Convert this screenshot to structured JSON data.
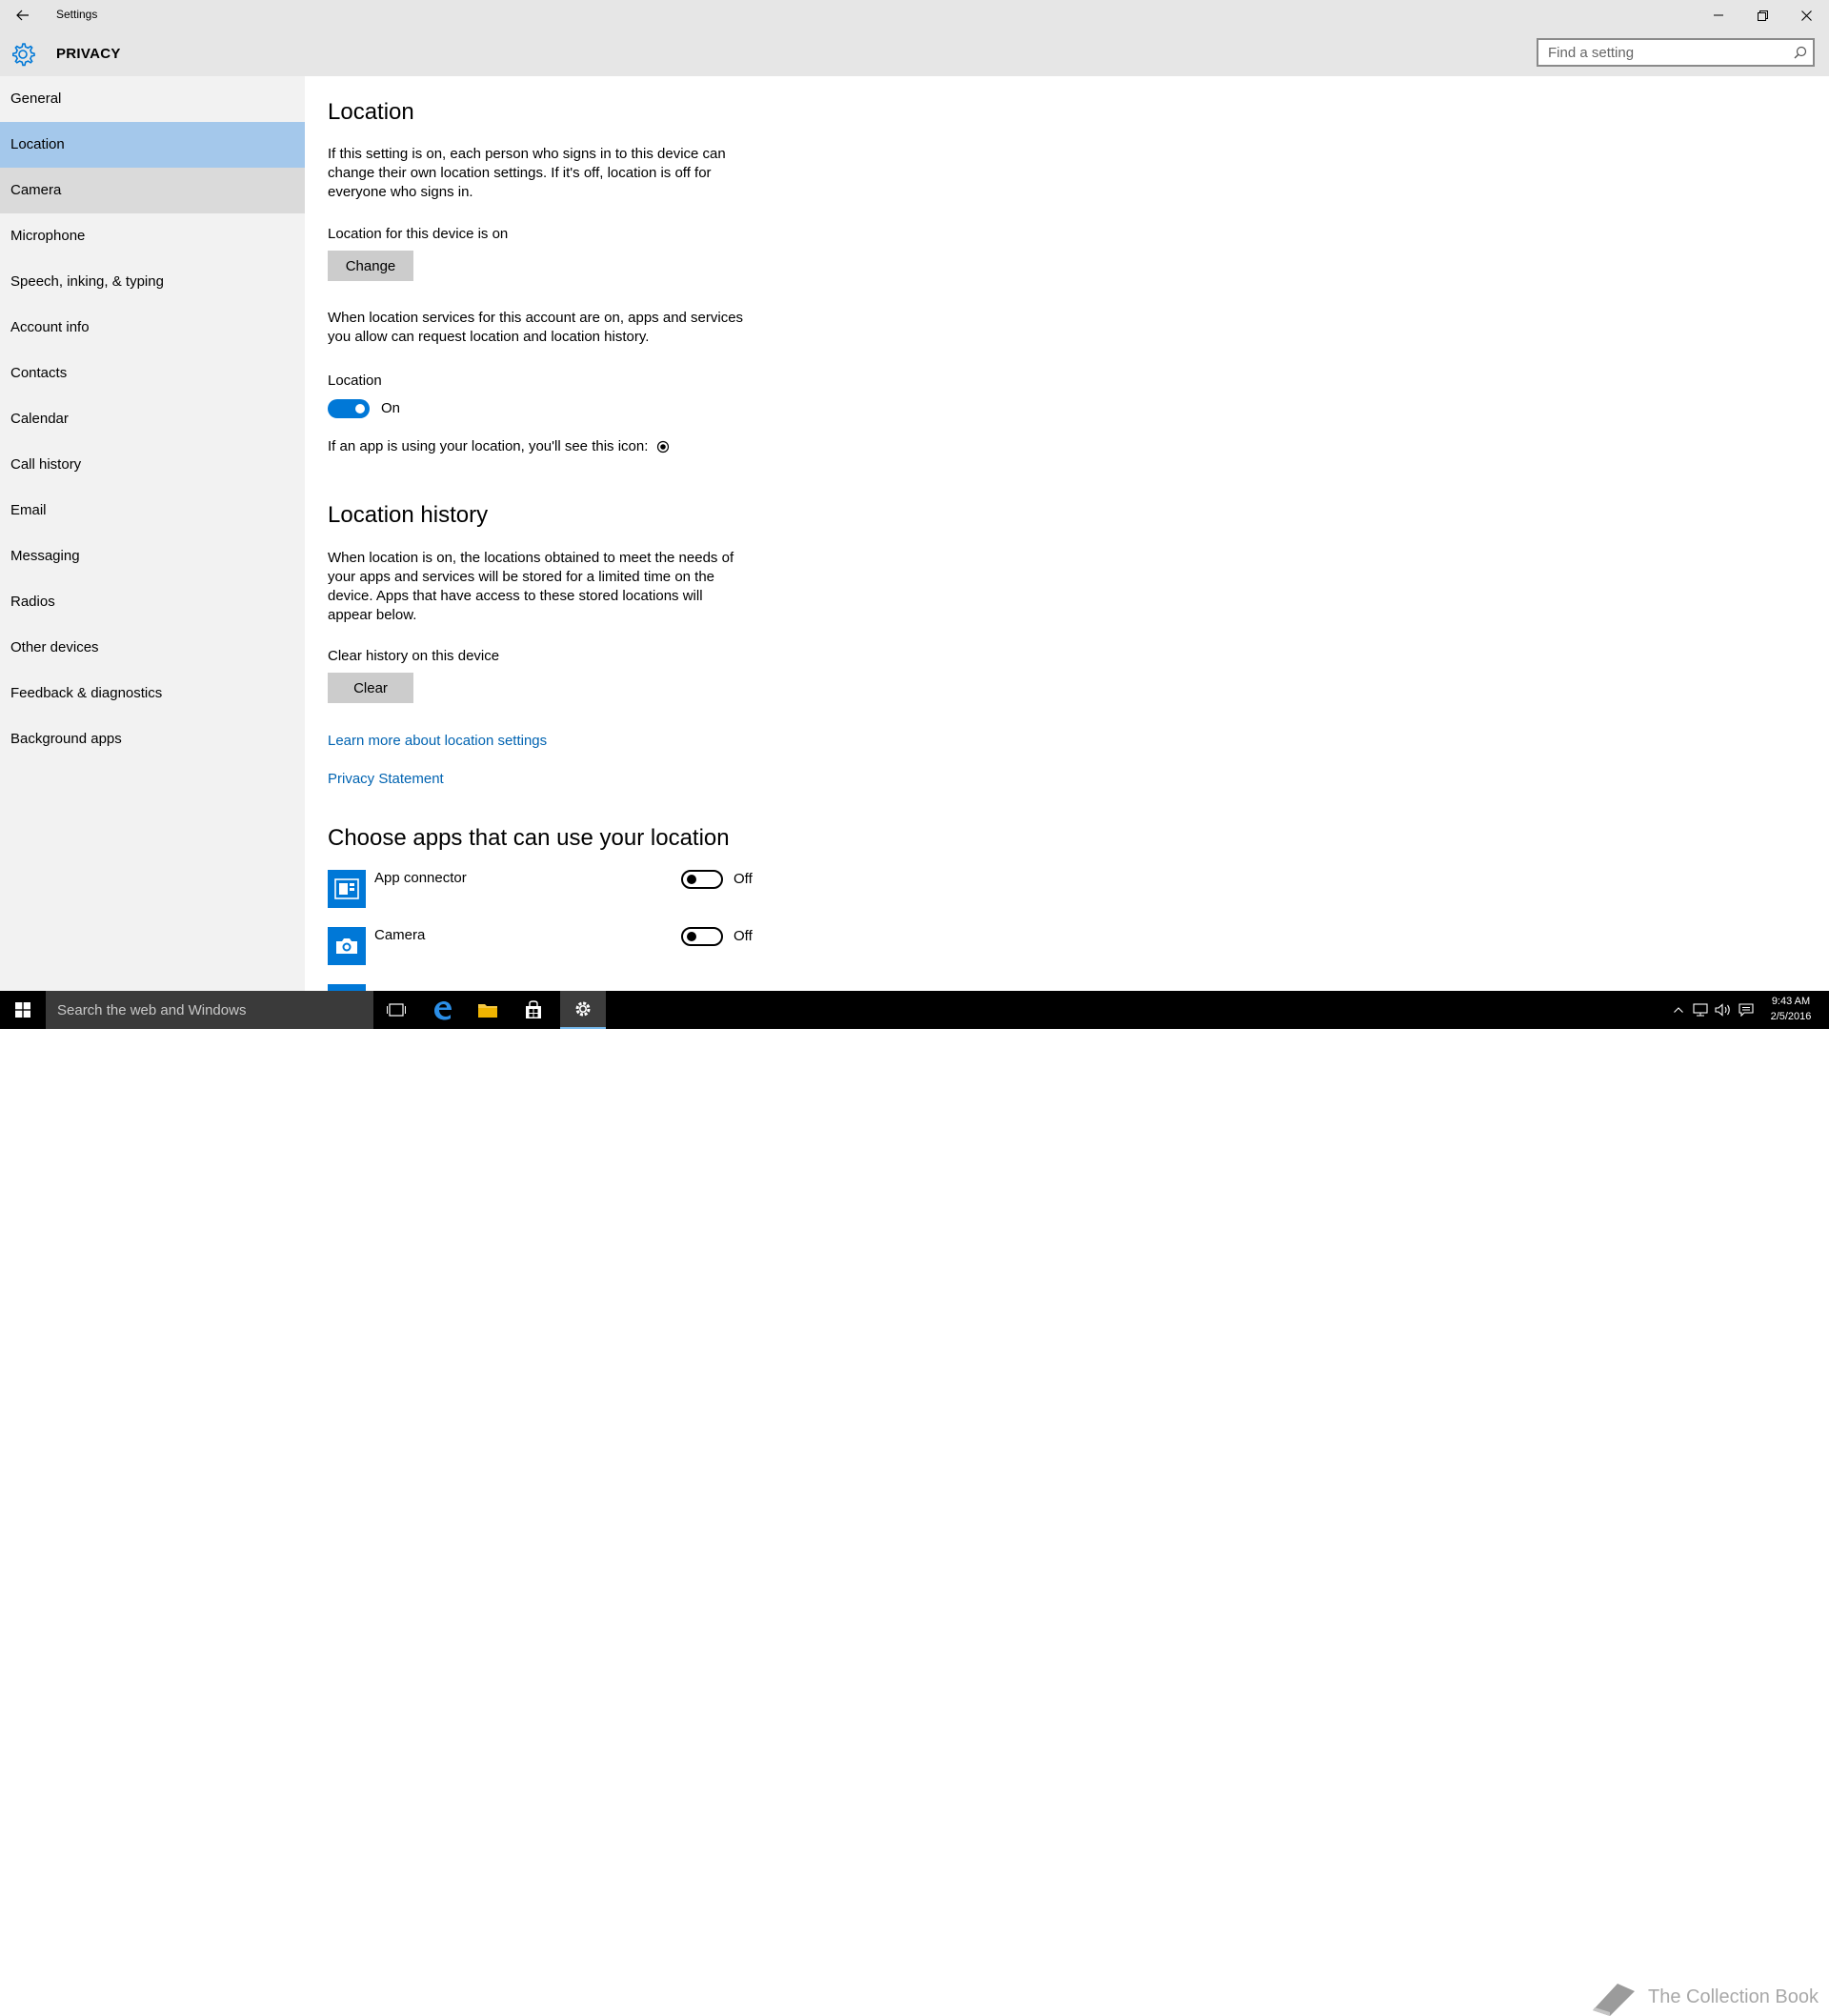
{
  "window": {
    "app_title": "Settings",
    "section_title": "PRIVACY",
    "search_placeholder": "Find a setting"
  },
  "sidebar": {
    "items": [
      {
        "label": "General"
      },
      {
        "label": "Location",
        "state": "selected"
      },
      {
        "label": "Camera",
        "state": "hover"
      },
      {
        "label": "Microphone"
      },
      {
        "label": "Speech, inking, & typing"
      },
      {
        "label": "Account info"
      },
      {
        "label": "Contacts"
      },
      {
        "label": "Calendar"
      },
      {
        "label": "Call history"
      },
      {
        "label": "Email"
      },
      {
        "label": "Messaging"
      },
      {
        "label": "Radios"
      },
      {
        "label": "Other devices"
      },
      {
        "label": "Feedback & diagnostics"
      },
      {
        "label": "Background apps"
      }
    ]
  },
  "main": {
    "location": {
      "heading": "Location",
      "description": "If this setting is on, each person who signs in to this device can change their own location settings. If it's off, location is off for everyone who signs in.",
      "device_status": "Location for this device is on",
      "change_button": "Change",
      "services_description": "When location services for this account are on, apps and services you allow can request location and location history.",
      "toggle_label": "Location",
      "toggle_state": "On",
      "icon_note": "If an app is using your location, you'll see this icon:"
    },
    "history": {
      "heading": "Location history",
      "description": "When location is on, the locations obtained to meet the needs of your apps and services will be stored for a limited time on the device. Apps that have access to these stored locations will appear below.",
      "clear_label": "Clear history on this device",
      "clear_button": "Clear",
      "learn_more_link": "Learn more about location settings",
      "privacy_link": "Privacy Statement"
    },
    "apps": {
      "heading": "Choose apps that can use your location",
      "list": [
        {
          "name": "App connector",
          "state": "Off",
          "icon": "app-connector-icon"
        },
        {
          "name": "Camera",
          "state": "Off",
          "icon": "camera-icon"
        }
      ]
    }
  },
  "taskbar": {
    "search_placeholder": "Search the web and Windows",
    "clock_time": "9:43 AM",
    "clock_date": "2/5/2016",
    "watermark": "The Collection Book"
  },
  "colors": {
    "accent": "#0078d7",
    "selected_nav": "#a4c8eb",
    "link": "#0063b1"
  }
}
